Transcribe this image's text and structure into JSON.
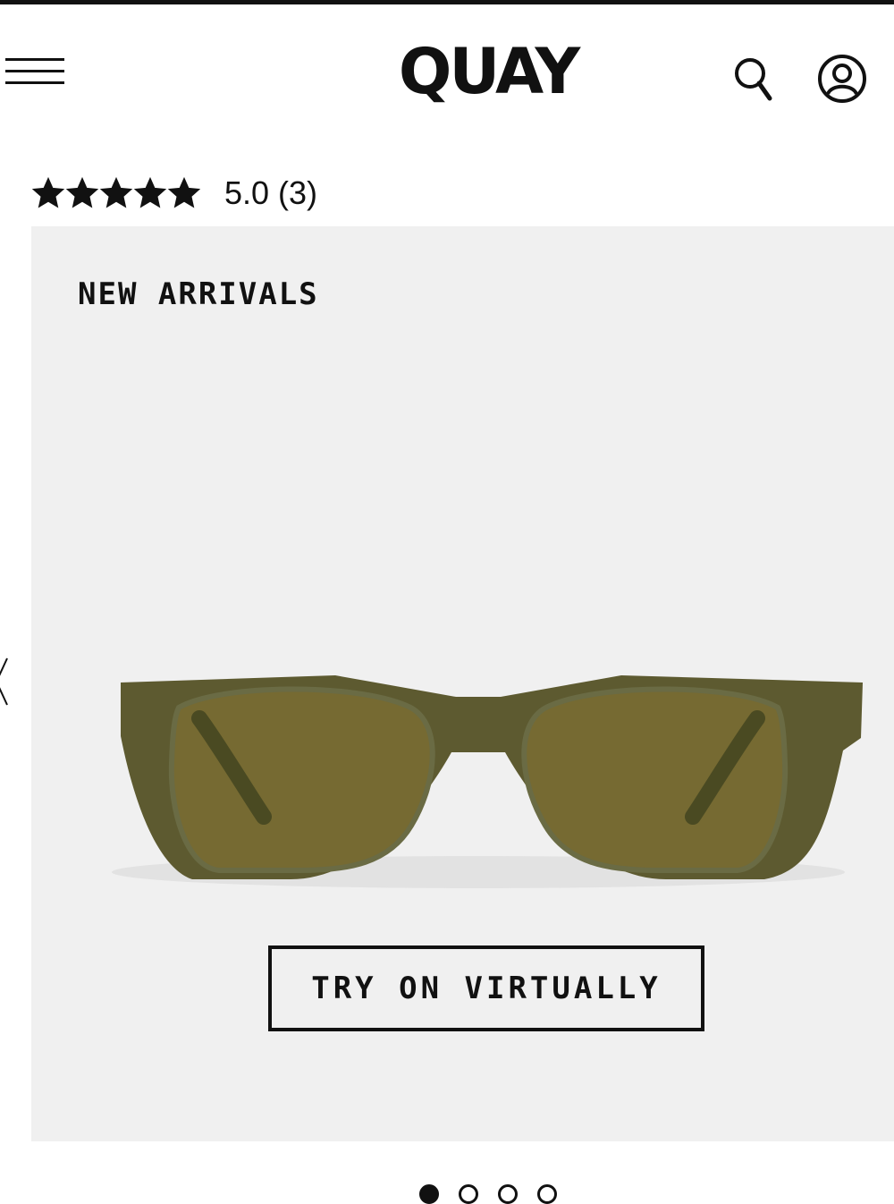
{
  "header": {
    "logo_text": "QUAY",
    "menu_icon": "hamburger-menu-icon",
    "search_icon": "search-icon",
    "account_icon": "account-icon"
  },
  "rating": {
    "stars": 5,
    "max_stars": 5,
    "text": "5.0 (3)"
  },
  "gallery": {
    "badge": "NEW ARRIVALS",
    "try_on_label": "TRY ON VIRTUALLY",
    "prev_icon": "chevron-left-icon",
    "slide_count": 4,
    "active_slide": 1
  },
  "colors": {
    "text": "#111111",
    "gallery_background": "#f0f0f0",
    "frame": "#5d5a30",
    "lens": "#766a32"
  }
}
